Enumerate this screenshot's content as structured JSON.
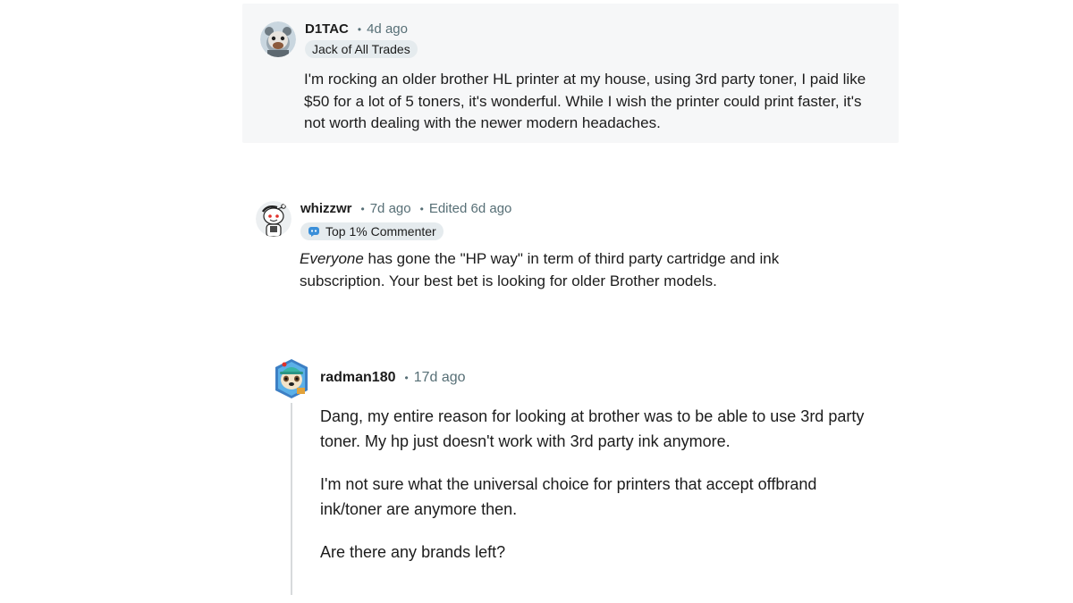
{
  "comments": [
    {
      "username": "D1TAC",
      "time": "4d ago",
      "flair": "Jack of All Trades",
      "avatar_icon": "snoo-avatar-icon",
      "body": "I'm rocking an older brother HL printer at my house, using 3rd party toner, I paid like $50 for a lot of 5 toners, it's wonderful. While I wish the printer could print faster, it's not worth dealing with the newer modern headaches."
    },
    {
      "username": "whizzwr",
      "time": "7d ago",
      "edited": "Edited 6d ago",
      "flair": "Top 1% Commenter",
      "flair_icon": "top-commenter-icon",
      "avatar_icon": "snoo-avatar-icon",
      "body_emphasis": "Everyone",
      "body_rest": " has gone the \"HP way\" in term of third party cartridge and ink subscription. Your best bet is looking for older Brother models."
    },
    {
      "username": "radman180",
      "time": "17d ago",
      "avatar_icon": "snoo-avatar-icon",
      "paragraphs": [
        "Dang, my entire reason for looking at brother was to be able to use 3rd party toner. My hp just doesn't work with 3rd party ink anymore.",
        "I'm not sure what the universal choice for printers that accept offbrand ink/toner are anymore then.",
        "Are there any brands left?"
      ]
    }
  ],
  "meta_separator": "•",
  "colors": {
    "highlight_bg": "#f6f7f8",
    "meta_text": "#576f76",
    "flair_bg": "#e5ebee",
    "thread_line": "#d7dadc"
  }
}
